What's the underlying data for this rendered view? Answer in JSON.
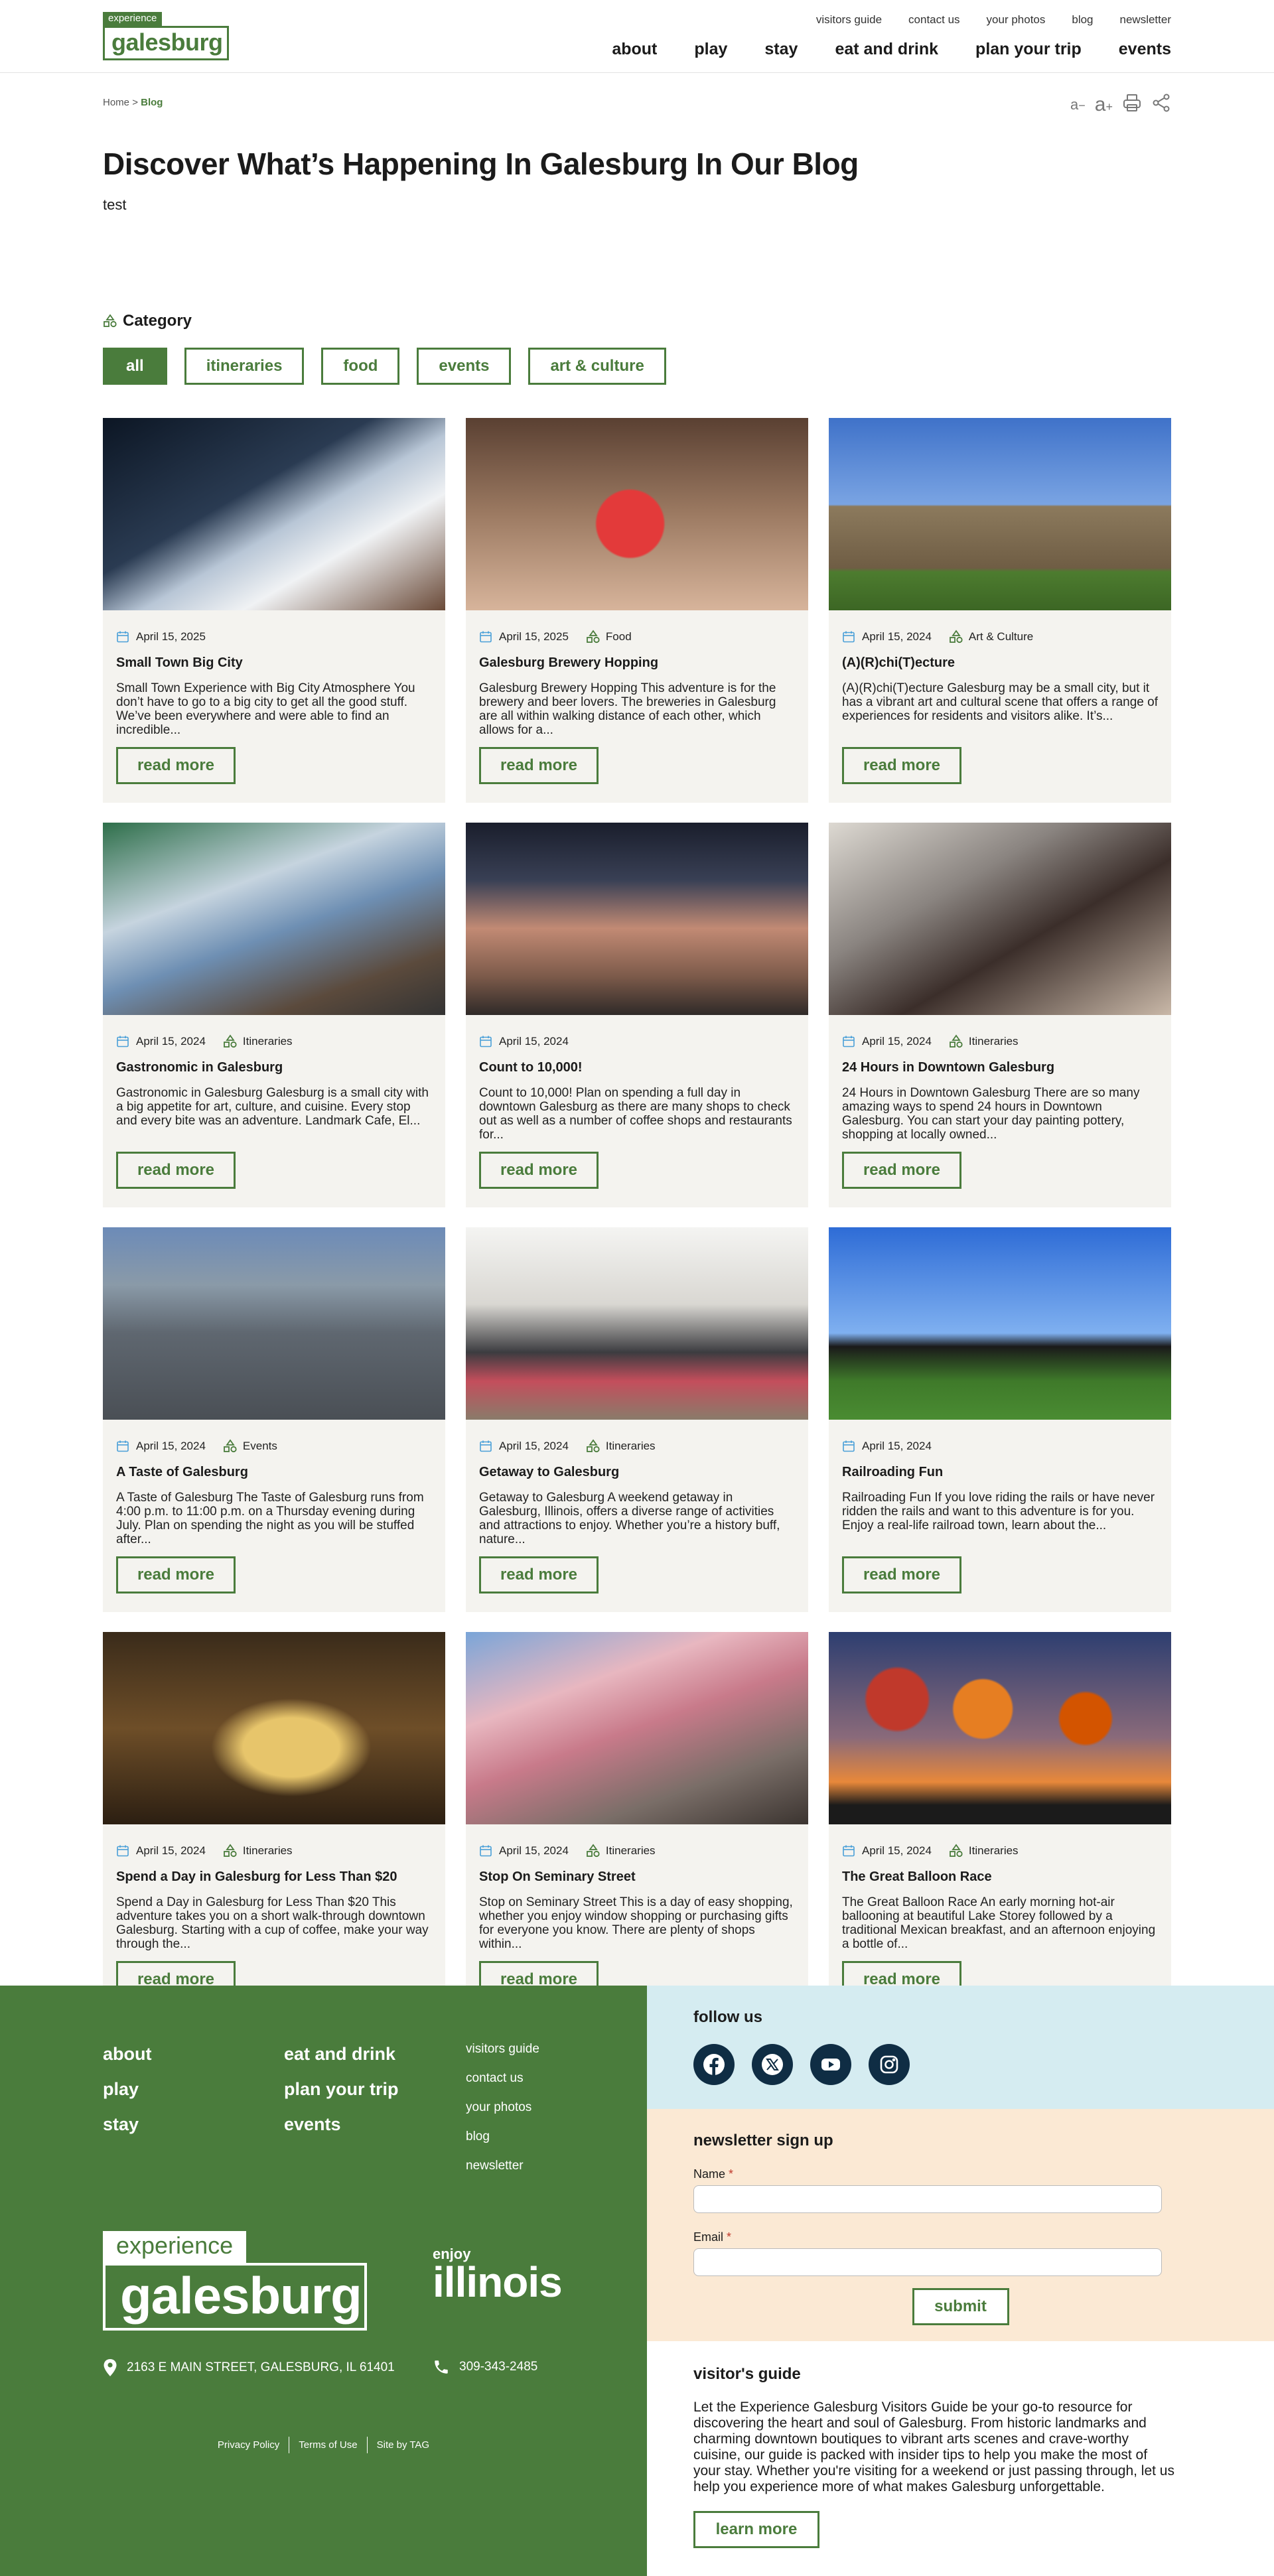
{
  "header": {
    "logo_top": "experience",
    "logo_main": "galesburg",
    "utility_nav": [
      "visitors guide",
      "contact us",
      "your photos",
      "blog",
      "newsletter"
    ],
    "main_nav": [
      "about",
      "play",
      "stay",
      "eat and drink",
      "plan your trip",
      "events"
    ]
  },
  "breadcrumb": {
    "home": "Home",
    "separator": ">",
    "current": "Blog"
  },
  "tools": {
    "decrease": "a",
    "minus": "−",
    "increase": "a",
    "plus": "+",
    "print_icon": "printer-icon",
    "share_icon": "share-icon"
  },
  "hero": {
    "title": "Discover What’s Happening In Galesburg In Our Blog",
    "subtitle": "test"
  },
  "category": {
    "label": "Category",
    "filters": [
      "all",
      "itineraries",
      "food",
      "events",
      "art & culture"
    ],
    "active": "all"
  },
  "cards": [
    {
      "date": "April 15, 2025",
      "category": "",
      "title": "Small Town Big City",
      "excerpt": "Small Town Experience with Big City Atmosphere You don’t have to go to a big city to get all the good stuff. We’ve been everywhere and were able to find an incredible...",
      "button": "read more"
    },
    {
      "date": "April 15, 2025",
      "category": "Food",
      "title": "Galesburg Brewery Hopping",
      "excerpt": "Galesburg Brewery Hopping This adventure is for the brewery and beer lovers. The breweries in Galesburg are all within walking distance of each other, which allows for a...",
      "button": "read more"
    },
    {
      "date": "April 15, 2024",
      "category": "Art & Culture",
      "title": "(A)(R)chi(T)ecture",
      "excerpt": "(A)(R)chi(T)ecture Galesburg may be a small city, but it has a vibrant art and cultural scene that offers a range of experiences for residents and visitors alike. It’s...",
      "button": "read more"
    },
    {
      "date": "April 15, 2024",
      "category": "Itineraries",
      "title": "Gastronomic in Galesburg",
      "excerpt": "Gastronomic in Galesburg Galesburg is a small city with a big appetite for art, culture, and cuisine. Every stop and every bite was an adventure. Landmark Cafe, El...",
      "button": "read more"
    },
    {
      "date": "April 15, 2024",
      "category": "",
      "title": "Count to 10,000!",
      "excerpt": "Count to 10,000! Plan on spending a full day in downtown Galesburg as there are many shops to check out as well as a number of coffee shops and restaurants for...",
      "button": "read more"
    },
    {
      "date": "April 15, 2024",
      "category": "Itineraries",
      "title": "24 Hours in Downtown Galesburg",
      "excerpt": "24 Hours in Downtown Galesburg There are so many amazing ways to spend 24 hours in Downtown Galesburg. You can start your day painting pottery, shopping at locally owned...",
      "button": "read more"
    },
    {
      "date": "April 15, 2024",
      "category": "Events",
      "title": "A Taste of Galesburg",
      "excerpt": "A Taste of Galesburg The Taste of Galesburg runs from 4:00 p.m. to 11:00 p.m. on a Thursday evening during July. Plan on spending the night as you will be stuffed after...",
      "button": "read more"
    },
    {
      "date": "April 15, 2024",
      "category": "Itineraries",
      "title": "Getaway to Galesburg",
      "excerpt": "Getaway to Galesburg A weekend getaway in Galesburg, Illinois, offers a diverse range of activities and attractions to enjoy. Whether you’re a history buff, nature...",
      "button": "read more"
    },
    {
      "date": "April 15, 2024",
      "category": "",
      "title": "Railroading Fun",
      "excerpt": "Railroading Fun If you love riding the rails or have never ridden the rails and want to this adventure is for you. Enjoy a real-life railroad town, learn about the...",
      "button": "read more"
    },
    {
      "date": "April 15, 2024",
      "category": "Itineraries",
      "title": "Spend a Day in Galesburg for Less Than $20",
      "excerpt": "Spend a Day in Galesburg for Less Than $20 This adventure takes you on a short walk-through downtown Galesburg. Starting with a cup of coffee, make your way through the...",
      "button": "read more"
    },
    {
      "date": "April 15, 2024",
      "category": "Itineraries",
      "title": "Stop On Seminary Street",
      "excerpt": "Stop on Seminary Street This is a day of easy shopping, whether you enjoy window shopping or purchasing gifts for everyone you know. There are plenty of shops within...",
      "button": "read more"
    },
    {
      "date": "April 15, 2024",
      "category": "Itineraries",
      "title": "The Great Balloon Race",
      "excerpt": "The Great Balloon Race An early morning hot-air ballooning at beautiful Lake Storey followed by a traditional Mexican breakfast, and an afternoon enjoying a bottle of...",
      "button": "read more"
    }
  ],
  "footer": {
    "col1": [
      "about",
      "play",
      "stay"
    ],
    "col2": [
      "eat and drink",
      "plan your trip",
      "events"
    ],
    "col3": [
      "visitors guide",
      "contact us",
      "your photos",
      "blog",
      "newsletter"
    ],
    "logo_top": "experience",
    "logo_main": "galesburg",
    "enjoy": "enjoy",
    "illinois": "illinois",
    "address": "2163 E MAIN STREET, GALESBURG, IL 61401",
    "phone": "309-343-2485",
    "legal": [
      "Privacy Policy",
      "Terms of Use",
      "Site by TAG"
    ],
    "follow_title": "follow us",
    "socials": [
      "facebook-icon",
      "x-icon",
      "youtube-icon",
      "instagram-icon"
    ],
    "newsletter_title": "newsletter sign up",
    "name_label": "Name",
    "email_label": "Email",
    "required_mark": "*",
    "submit": "submit",
    "guide_title": "visitor's guide",
    "guide_text": "Let the Experience Galesburg Visitors Guide be your go-to resource for discovering the heart and soul of Galesburg. From historic landmarks and charming downtown boutiques to vibrant arts scenes and crave-worthy cuisine, our guide is packed with insider tips to help you make the most of your stay. Whether you're visiting for a weekend or just passing through, let us help you experience more of what makes Galesburg unforgettable.",
    "learn_more": "learn more"
  },
  "colors": {
    "brand_green": "#4a7c3c",
    "card_bg": "#f4f3ef",
    "follow_bg": "#d5ecf1",
    "newsletter_bg": "#fbe9d4",
    "social_navy": "#0f2d44"
  }
}
